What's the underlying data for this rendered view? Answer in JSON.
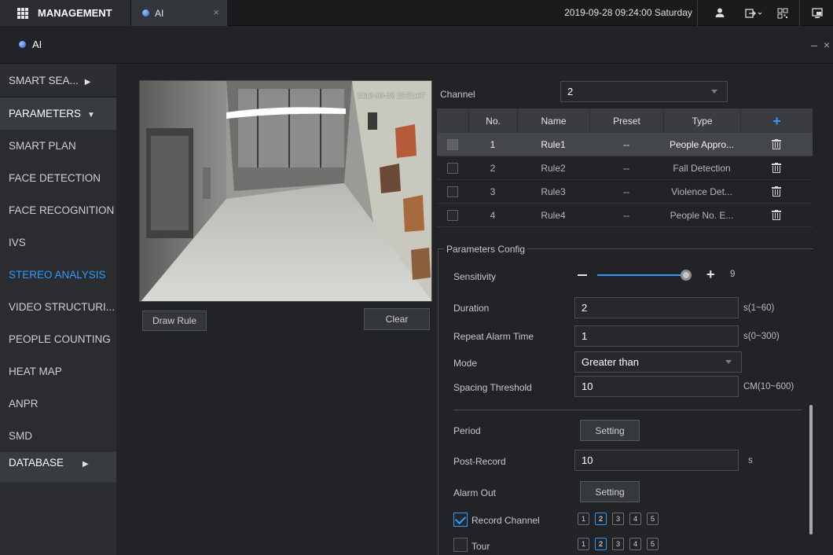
{
  "topbar": {
    "management_label": "MANAGEMENT",
    "tab_label": "AI",
    "tab_close": "×",
    "datetime": "2019-09-28 09:24:00 Saturday"
  },
  "titlebar": {
    "title": "AI",
    "controls": "– ×"
  },
  "sidebar": {
    "items": [
      {
        "label": "SMART SEA...",
        "caret": "▶"
      },
      {
        "label": "PARAMETERS",
        "caret": "▼"
      },
      {
        "label": "SMART PLAN"
      },
      {
        "label": "FACE DETECTION"
      },
      {
        "label": "FACE RECOGNITION"
      },
      {
        "label": "IVS"
      },
      {
        "label": "STEREO ANALYSIS"
      },
      {
        "label": "VIDEO STRUCTURI..."
      },
      {
        "label": "PEOPLE COUNTING"
      },
      {
        "label": "HEAT MAP"
      },
      {
        "label": "ANPR"
      },
      {
        "label": "SMD"
      },
      {
        "label": "DATABASE",
        "caret": "▶"
      }
    ]
  },
  "video": {
    "timestamp": "2019-09-28 23:51:07",
    "draw_rule_label": "Draw Rule",
    "clear_label": "Clear"
  },
  "channel": {
    "label": "Channel",
    "value": "2"
  },
  "table": {
    "headers": {
      "no": "No.",
      "name": "Name",
      "preset": "Preset",
      "type": "Type",
      "add": "+"
    },
    "rows": [
      {
        "no": "1",
        "name": "Rule1",
        "preset": "--",
        "type": "People Appro..."
      },
      {
        "no": "2",
        "name": "Rule2",
        "preset": "--",
        "type": "Fall Detection"
      },
      {
        "no": "3",
        "name": "Rule3",
        "preset": "--",
        "type": "Violence Det..."
      },
      {
        "no": "4",
        "name": "Rule4",
        "preset": "--",
        "type": "People No. E..."
      }
    ]
  },
  "config": {
    "legend": "Parameters Config",
    "sensitivity_label": "Sensitivity",
    "sensitivity_value": "9",
    "sensitivity_level": 0.9,
    "duration_label": "Duration",
    "duration_value": "2",
    "duration_unit": "s(1~60)",
    "repeat_label": "Repeat Alarm Time",
    "repeat_value": "1",
    "repeat_unit": "s(0~300)",
    "mode_label": "Mode",
    "mode_value": "Greater than",
    "spacing_label": "Spacing Threshold",
    "spacing_value": "10",
    "spacing_unit": "CM(10~600)",
    "period_label": "Period",
    "period_button": "Setting",
    "post_record_label": "Post-Record",
    "post_record_value": "10",
    "post_record_unit": "s",
    "alarm_out_label": "Alarm Out",
    "alarm_out_button": "Setting",
    "record_channel_label": "Record Channel",
    "tour_label": "Tour",
    "channels": [
      "1",
      "2",
      "3",
      "4",
      "5"
    ]
  },
  "colors": {
    "accent": "#2e9bff",
    "background": "#222326",
    "sidebar": "#2c2e32"
  }
}
